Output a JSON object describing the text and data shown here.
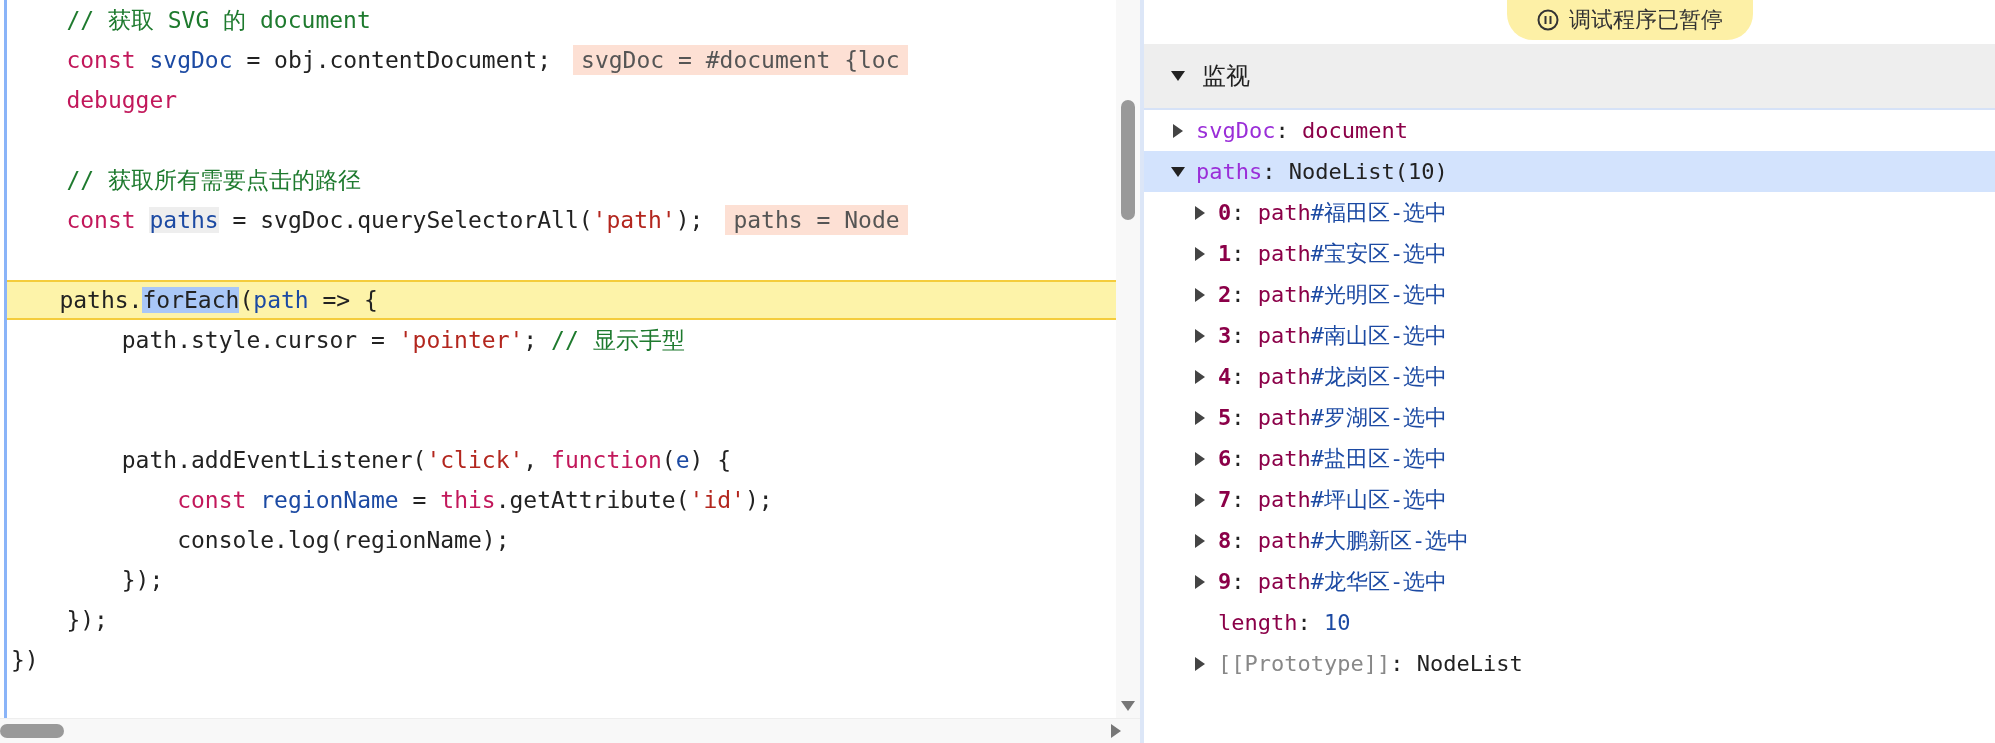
{
  "editor": {
    "lines": [
      {
        "current": false,
        "tokens": [
          {
            "kind": "comment",
            "text": "    // 获取 SVG 的 document"
          }
        ]
      },
      {
        "current": false,
        "tokens": [
          {
            "kind": "keyword",
            "text": "    const "
          },
          {
            "kind": "variable",
            "text": "svgDoc"
          },
          {
            "kind": "plain",
            "text": " = obj.contentDocument;"
          }
        ],
        "inline_value": "svgDoc = #document {loc"
      },
      {
        "current": false,
        "tokens": [
          {
            "kind": "keyword",
            "text": "    debugger"
          }
        ]
      },
      {
        "current": false
      },
      {
        "current": false,
        "tokens": [
          {
            "kind": "comment",
            "text": "    // 获取所有需要点击的路径"
          }
        ]
      },
      {
        "current": false,
        "tokens": [
          {
            "kind": "keyword",
            "text": "    const "
          },
          {
            "kind": "hovered",
            "text": "paths"
          },
          {
            "kind": "plain",
            "text": " = svgDoc.querySelectorAll("
          },
          {
            "kind": "string",
            "text": "'path'"
          },
          {
            "kind": "plain",
            "text": ");"
          }
        ],
        "inline_value": "paths = Node"
      },
      {
        "current": false
      },
      {
        "current": true,
        "tokens": [
          {
            "kind": "plain",
            "text": "    paths."
          },
          {
            "kind": "selection",
            "text": "forEach"
          },
          {
            "kind": "plain",
            "text": "("
          },
          {
            "kind": "variable",
            "text": "path"
          },
          {
            "kind": "plain",
            "text": " => {"
          }
        ]
      },
      {
        "current": false,
        "tokens": [
          {
            "kind": "plain",
            "text": "        path.style.cursor = "
          },
          {
            "kind": "string",
            "text": "'pointer'"
          },
          {
            "kind": "plain",
            "text": "; "
          },
          {
            "kind": "comment",
            "text": "// 显示手型"
          }
        ]
      },
      {
        "current": false
      },
      {
        "current": false
      },
      {
        "current": false,
        "tokens": [
          {
            "kind": "plain",
            "text": "        path.addEventListener("
          },
          {
            "kind": "string",
            "text": "'click'"
          },
          {
            "kind": "plain",
            "text": ", "
          },
          {
            "kind": "keyword",
            "text": "function"
          },
          {
            "kind": "plain",
            "text": "("
          },
          {
            "kind": "variable",
            "text": "e"
          },
          {
            "kind": "plain",
            "text": ") {"
          }
        ]
      },
      {
        "current": false,
        "tokens": [
          {
            "kind": "keyword",
            "text": "            const "
          },
          {
            "kind": "variable",
            "text": "regionName"
          },
          {
            "kind": "plain",
            "text": " = "
          },
          {
            "kind": "keyword",
            "text": "this"
          },
          {
            "kind": "plain",
            "text": ".getAttribute("
          },
          {
            "kind": "string",
            "text": "'id'"
          },
          {
            "kind": "plain",
            "text": ");"
          }
        ]
      },
      {
        "current": false,
        "tokens": [
          {
            "kind": "plain",
            "text": "            console.log(regionName);"
          }
        ]
      },
      {
        "current": false,
        "tokens": [
          {
            "kind": "plain",
            "text": "        });"
          }
        ]
      },
      {
        "current": false,
        "tokens": [
          {
            "kind": "plain",
            "text": "    });"
          }
        ]
      },
      {
        "current": false,
        "tokens": [
          {
            "kind": "plain",
            "text": "})"
          }
        ]
      }
    ]
  },
  "status_badge": {
    "text": "调试程序已暂停"
  },
  "watch": {
    "title": "监视",
    "expanded": true,
    "expressions": [
      {
        "name": "svgDoc",
        "sep": ":",
        "value": "document",
        "expanded": false,
        "selected": false
      },
      {
        "name": "paths",
        "sep": ":",
        "value": "NodeList(10)",
        "expanded": true,
        "selected": true,
        "children": [
          {
            "kind": "element",
            "key": "0",
            "sep": ":",
            "tag": "path",
            "id": "#福田区-选中"
          },
          {
            "kind": "element",
            "key": "1",
            "sep": ":",
            "tag": "path",
            "id": "#宝安区-选中"
          },
          {
            "kind": "element",
            "key": "2",
            "sep": ":",
            "tag": "path",
            "id": "#光明区-选中"
          },
          {
            "kind": "element",
            "key": "3",
            "sep": ":",
            "tag": "path",
            "id": "#南山区-选中"
          },
          {
            "kind": "element",
            "key": "4",
            "sep": ":",
            "tag": "path",
            "id": "#龙岗区-选中"
          },
          {
            "kind": "element",
            "key": "5",
            "sep": ":",
            "tag": "path",
            "id": "#罗湖区-选中"
          },
          {
            "kind": "element",
            "key": "6",
            "sep": ":",
            "tag": "path",
            "id": "#盐田区-选中"
          },
          {
            "kind": "element",
            "key": "7",
            "sep": ":",
            "tag": "path",
            "id": "#坪山区-选中"
          },
          {
            "kind": "element",
            "key": "8",
            "sep": ":",
            "tag": "path",
            "id": "#大鹏新区-选中"
          },
          {
            "kind": "element",
            "key": "9",
            "sep": ":",
            "tag": "path",
            "id": "#龙华区-选中"
          },
          {
            "kind": "number",
            "key": "length",
            "sep": ":",
            "value": "10"
          },
          {
            "kind": "internal",
            "key": "[[Prototype]]",
            "sep": ":",
            "value": "NodeList"
          }
        ]
      }
    ]
  }
}
